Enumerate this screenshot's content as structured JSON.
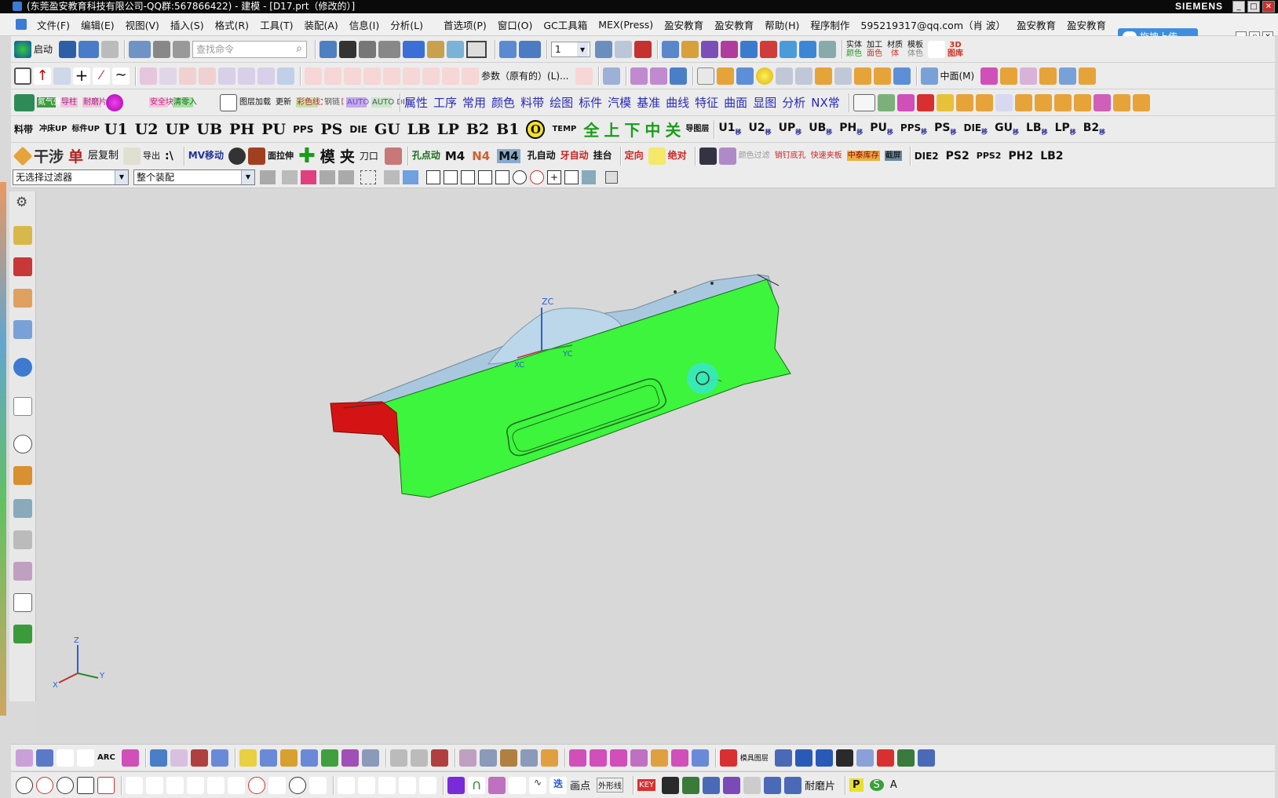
{
  "window": {
    "title": "(东莞盈安教育科技有限公司-QQ群:567866422) - 建模 - [D17.prt（修改的）]",
    "brand": "SIEMENS",
    "controls": [
      "_",
      "□",
      "✕"
    ]
  },
  "menu": {
    "items": [
      "文件(F)",
      "编辑(E)",
      "视图(V)",
      "插入(S)",
      "格式(R)",
      "工具(T)",
      "装配(A)",
      "信息(I)",
      "分析(L)",
      "首选项(P)",
      "窗口(O)",
      "GC工具箱",
      "MEX(Press)",
      "盈安教育",
      "盈安教育",
      "帮助(H)",
      "程序制作",
      "595219317@qq.com（肖 波）",
      "盈安教育",
      "盈安教育"
    ],
    "upload_label": "拖拽上传"
  },
  "toolbar1": {
    "start_label": "启动",
    "search_placeholder": "查找命令",
    "layer_value": "1",
    "right_labels": [
      "实体",
      "颜色",
      "加工",
      "面色",
      "材质",
      "体",
      "模板",
      "体色",
      "3D",
      "图库"
    ]
  },
  "toolbar2": {
    "param_label": "参数（原有的）(L)...",
    "midplane_label": "中面(M)"
  },
  "toolbar3": {
    "small_labels": [
      "氮气弹簧",
      "导柱",
      "耐磨片",
      "安全块",
      "清零入",
      "图层加载",
      "更新",
      "彩色线文本框",
      "钢链",
      "AUTO PH",
      "AUTO DIE"
    ],
    "cn_labels": [
      "属性",
      "工序",
      "常用",
      "颜色",
      "料带",
      "绘图",
      "标件",
      "汽模",
      "基准",
      "曲线",
      "特征",
      "曲面",
      "显图",
      "分析",
      "NX常"
    ]
  },
  "toolbar4": {
    "left_labels": [
      "料带",
      "冲床UP",
      "标件UP"
    ],
    "big_labels": [
      "U1",
      "U2",
      "UP",
      "UB",
      "PH",
      "PU"
    ],
    "pps_label": "PPS",
    "big_labels2": [
      "PS",
      "DIE",
      "GU",
      "LB",
      "LP",
      "B2",
      "B1"
    ],
    "o_label": "O",
    "temp_label": "TEMP",
    "colored_labels": [
      "全",
      "上",
      "下",
      "中",
      "关"
    ],
    "layer_label": "导图层",
    "shift_labels": [
      "U1",
      "U2",
      "UP",
      "UB",
      "PH",
      "PU",
      "PPS",
      "PS",
      "DIE",
      "GU",
      "LB",
      "LP",
      "B2"
    ],
    "shift_sub": "移"
  },
  "toolbar5": {
    "labels": [
      "干涉",
      "单",
      "层复制",
      "导出",
      "MV移动",
      "面拉伸",
      "模",
      "夹",
      "刀口",
      "孔点动",
      "M4",
      "N4",
      "M4",
      "孔自动",
      "牙自动",
      "挂台",
      "定向",
      "绝对",
      "颜色过滤",
      "销钉底孔",
      "快速夹板",
      "中泰库存",
      "截屏",
      "DIE2",
      "PS2",
      "PPS2",
      "PH2",
      "LB2"
    ]
  },
  "filterbar": {
    "filter_value": "无选择过滤器",
    "assembly_value": "整个装配"
  },
  "viewport": {
    "axis_labels": {
      "zc": "ZC",
      "yc": "YC",
      "xc": "XC"
    },
    "triad_labels": {
      "z": "Z",
      "y": "Y",
      "x": "X"
    },
    "colors": {
      "background": "#d8d8d8",
      "green_face": "#3cf53c",
      "blue_top": "#a9c8df",
      "red_face": "#d41414",
      "rotate_cursor": "#36e8c8"
    }
  },
  "bottom1": {
    "labels": [
      "ARC",
      "模具图层"
    ]
  },
  "bottom2": {
    "labels": [
      "画点",
      "外形线",
      "KEY",
      "耐磨片",
      "P",
      "S",
      "A"
    ]
  }
}
